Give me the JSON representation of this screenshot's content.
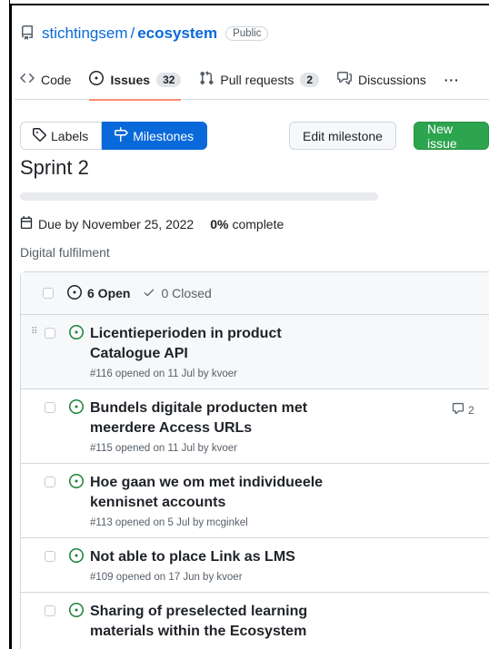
{
  "repo": {
    "owner": "stichtingsem",
    "separator": "/",
    "name": "ecosystem",
    "visibility": "Public"
  },
  "tabs": [
    {
      "label": "Code",
      "icon": "code-icon"
    },
    {
      "label": "Issues",
      "icon": "issue-opened-icon",
      "count": "32"
    },
    {
      "label": "Pull requests",
      "icon": "git-pull-request-icon",
      "count": "2"
    },
    {
      "label": "Discussions",
      "icon": "comment-discussion-icon"
    }
  ],
  "tab_more": "···",
  "toolbar": {
    "labels": "Labels",
    "milestones": "Milestones",
    "edit": "Edit milestone",
    "new_issue": "New issue"
  },
  "milestone": {
    "title": "Sprint 2",
    "due": "Due by November 25, 2022",
    "percent": "0%",
    "complete_label": "complete",
    "progress_fraction": 0,
    "description": "Digital fulfilment"
  },
  "issues_header": {
    "open": "6 Open",
    "closed": "0 Closed"
  },
  "issues": [
    {
      "title": "Licentieperioden in product Catalogue API",
      "meta": "#116 opened on 11 Jul by kvoer",
      "comments": ""
    },
    {
      "title": "Bundels digitale producten met meerdere Access URLs",
      "meta": "#115 opened on 11 Jul by kvoer",
      "comments": "2"
    },
    {
      "title": "Hoe gaan we om met individueele kennisnet accounts",
      "meta": "#113 opened on 5 Jul by mcginkel",
      "comments": ""
    },
    {
      "title": "Not able to place Link as LMS",
      "meta": "#109 opened on 17 Jun by kvoer",
      "comments": ""
    },
    {
      "title": "Sharing of preselected learning materials within the Ecosystem",
      "meta": "",
      "comments": ""
    }
  ],
  "colors": {
    "link": "#0969da",
    "primary": "#2da44e",
    "open_state": "#1a7f37",
    "tab_underline": "#fd8c73"
  }
}
